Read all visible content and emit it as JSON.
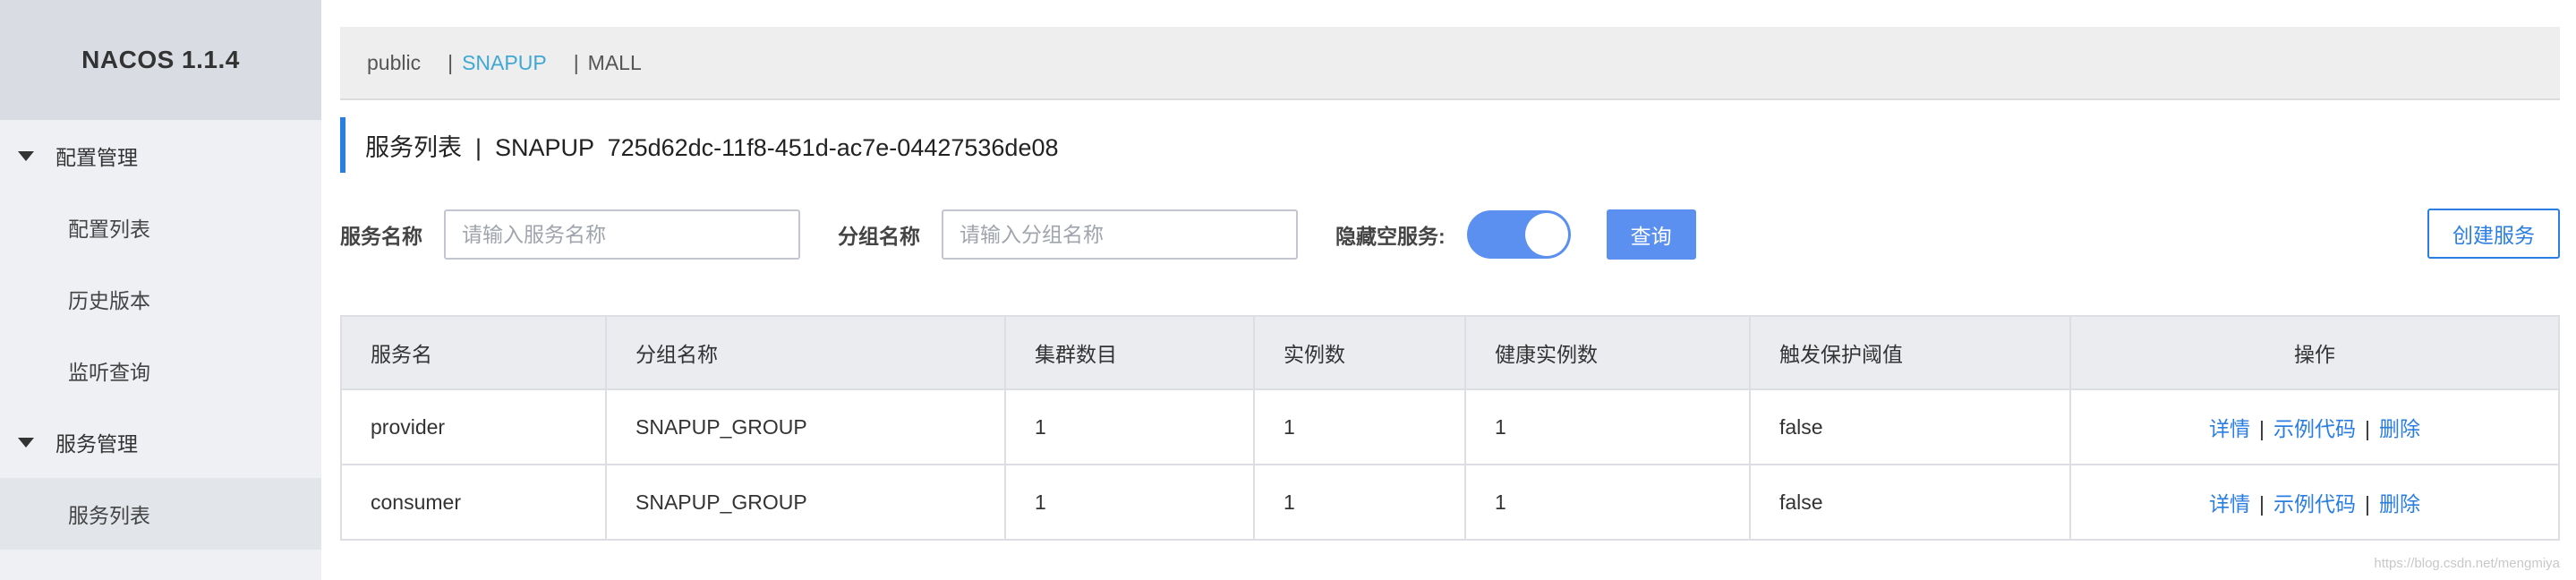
{
  "app": {
    "title": "NACOS 1.1.4"
  },
  "sidebar": {
    "groups": [
      {
        "label": "配置管理",
        "items": [
          {
            "label": "配置列表"
          },
          {
            "label": "历史版本"
          },
          {
            "label": "监听查询"
          }
        ]
      },
      {
        "label": "服务管理",
        "items": [
          {
            "label": "服务列表",
            "active": true
          }
        ]
      }
    ]
  },
  "namespaces": {
    "items": [
      {
        "label": "public"
      },
      {
        "label": "SNAPUP",
        "selected": true
      },
      {
        "label": "MALL"
      }
    ],
    "separator": "|"
  },
  "page": {
    "title": "服务列表  |  SNAPUP  725d62dc-11f8-451d-ac7e-04427536de08"
  },
  "filters": {
    "service_name_label": "服务名称",
    "service_name_placeholder": "请输入服务名称",
    "group_name_label": "分组名称",
    "group_name_placeholder": "请输入分组名称",
    "hide_empty_label": "隐藏空服务:",
    "hide_empty_enabled": true,
    "query_label": "查询",
    "create_label": "创建服务"
  },
  "table": {
    "columns": [
      "服务名",
      "分组名称",
      "集群数目",
      "实例数",
      "健康实例数",
      "触发保护阈值",
      "操作"
    ],
    "rows": [
      {
        "service": "provider",
        "group": "SNAPUP_GROUP",
        "clusters": "1",
        "instances": "1",
        "healthy": "1",
        "threshold": "false"
      },
      {
        "service": "consumer",
        "group": "SNAPUP_GROUP",
        "clusters": "1",
        "instances": "1",
        "healthy": "1",
        "threshold": "false"
      }
    ],
    "actions": {
      "detail": "详情",
      "sample_code": "示例代码",
      "delete": "删除",
      "separator": "|"
    }
  },
  "watermark": "https://blog.csdn.net/mengmiya",
  "colors": {
    "accent": "#2a7de1",
    "link_ns": "#41a8d3",
    "toggle": "#5b8ff0"
  }
}
